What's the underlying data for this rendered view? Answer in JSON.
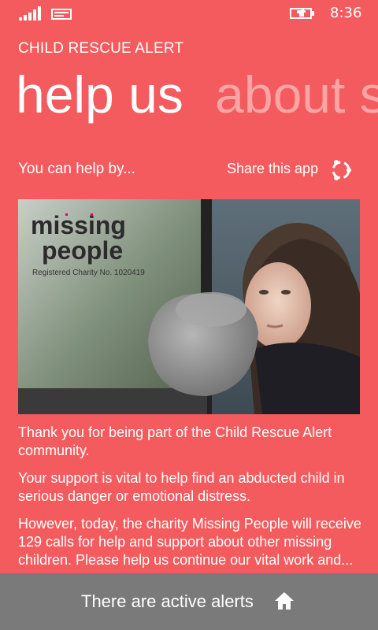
{
  "status_bar": {
    "time": "8:36"
  },
  "app": {
    "title": "CHILD RESCUE ALERT"
  },
  "pivot": {
    "items": [
      {
        "label": "help us"
      },
      {
        "label": "about su"
      }
    ]
  },
  "content": {
    "subheading": "You can help by...",
    "share_label": "Share this app",
    "photo": {
      "logo_line1": "missing",
      "logo_line2": "people",
      "charity_text": "Registered Charity No. 1020419"
    },
    "paragraphs": [
      "Thank you for being part of the Child Rescue Alert community.",
      "Your support is vital to help find an abducted child in serious danger or emotional distress.",
      "However, today, the charity Missing People will receive 129 calls for help and support about other missing children. Please help us continue our vital work and..."
    ]
  },
  "app_bar": {
    "label": "There are active alerts"
  },
  "colors": {
    "background": "#f45b5e",
    "app_bar": "#7a7a7a",
    "logo_accent": "#e5006d"
  }
}
